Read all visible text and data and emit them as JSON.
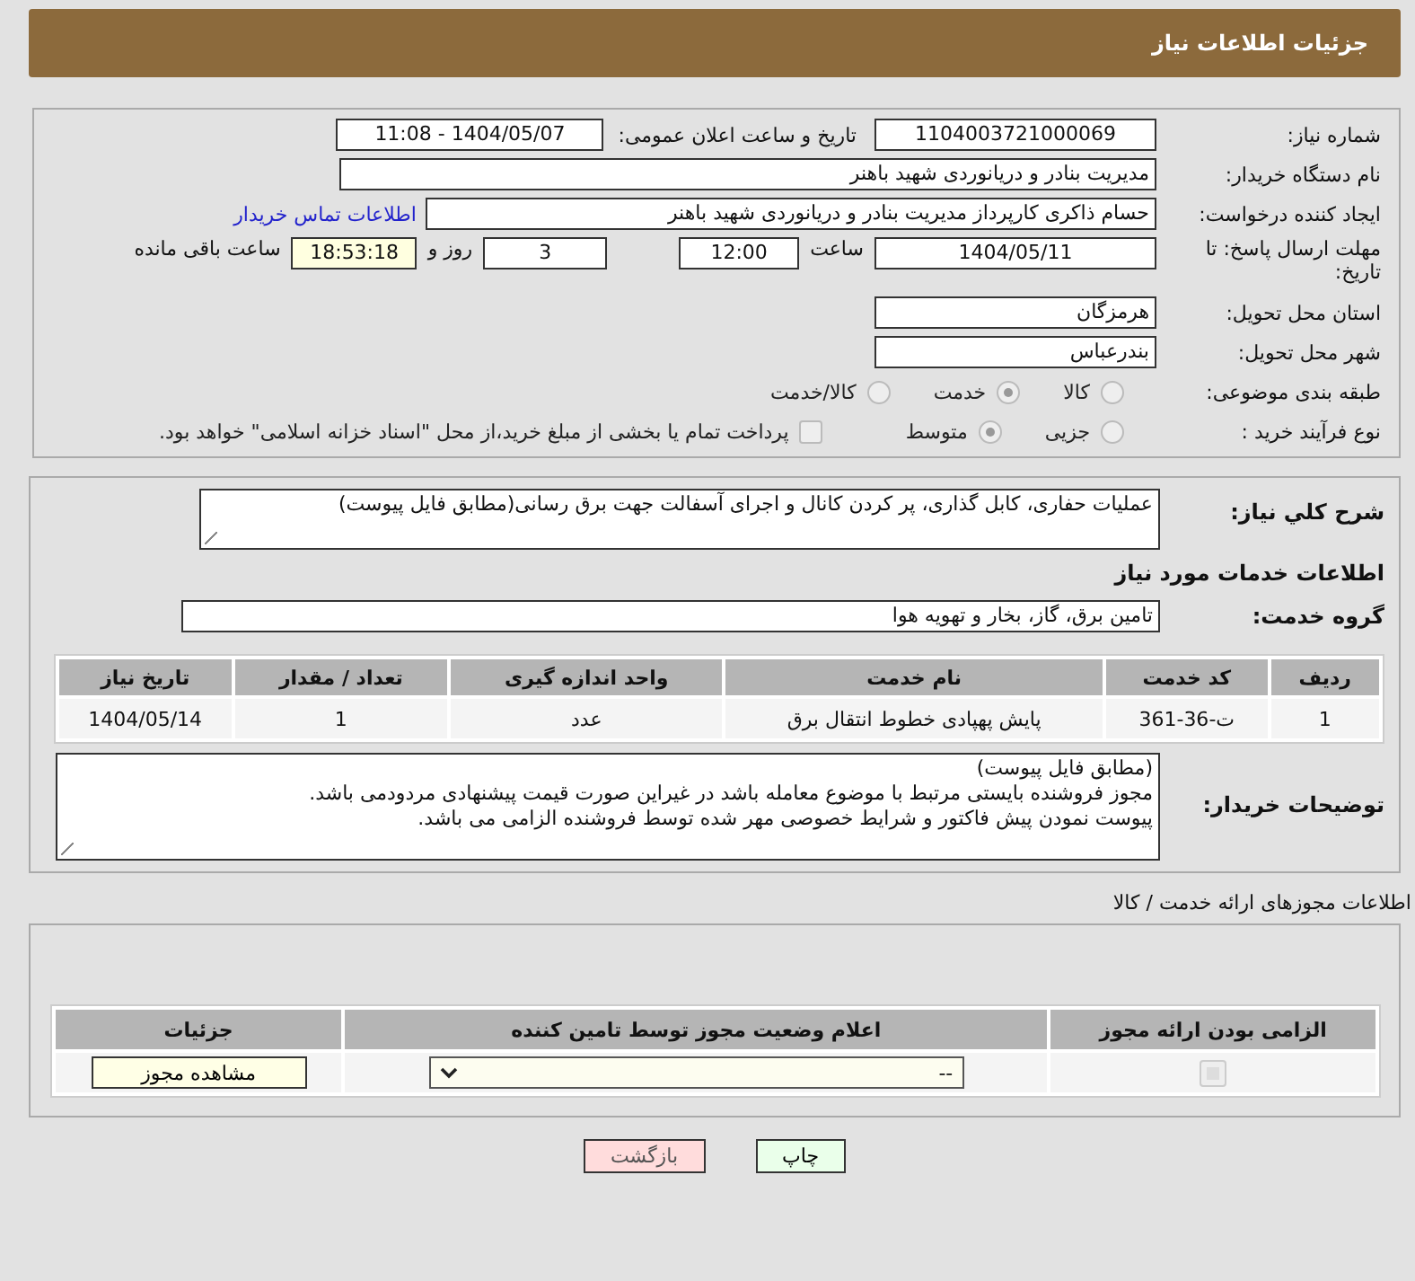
{
  "header": {
    "title": "جزئیات اطلاعات نیاز"
  },
  "details": {
    "need_number": {
      "label": "شماره نیاز:",
      "value": "1104003721000069"
    },
    "announce": {
      "label": "تاریخ و ساعت اعلان عمومی:",
      "value": "1404/05/07 - 11:08"
    },
    "buyer_org": {
      "label": "نام دستگاه خریدار:",
      "value": "مدیریت بنادر و دریانوردی شهید باهنر"
    },
    "requester": {
      "label": "ایجاد کننده درخواست:",
      "value": "حسام  ذاکری کارپرداز مدیریت بنادر و دریانوردی شهید باهنر",
      "link": "اطلاعات تماس خریدار"
    },
    "deadline": {
      "label": "مهلت ارسال پاسخ: تا تاریخ:",
      "date": "1404/05/11",
      "time_label": "ساعت",
      "time": "12:00",
      "days": "3",
      "days_label": "روز و",
      "remaining": "18:53:18",
      "remaining_label": "ساعت باقی مانده"
    },
    "province": {
      "label": "استان محل تحویل:",
      "value": "هرمزگان"
    },
    "city": {
      "label": "شهر محل تحویل:",
      "value": "بندرعباس"
    },
    "category": {
      "label": "طبقه بندی موضوعی:",
      "options": [
        {
          "label": "کالا",
          "selected": false
        },
        {
          "label": "خدمت",
          "selected": true
        },
        {
          "label": "کالا/خدمت",
          "selected": false
        }
      ]
    },
    "process": {
      "label": "نوع فرآیند خرید :",
      "options": [
        {
          "label": "جزیی",
          "selected": false
        },
        {
          "label": "متوسط",
          "selected": true
        }
      ],
      "treasury": {
        "checked": false,
        "label": "پرداخت تمام یا بخشی از مبلغ خرید،از محل \"اسناد خزانه اسلامی\" خواهد بود."
      }
    }
  },
  "services": {
    "summary": {
      "label": "شرح کلي نياز:",
      "value": "عملیات حفاری، کابل گذاری، پر کردن کانال و اجرای آسفالت جهت برق رسانی(مطابق فایل پیوست)"
    },
    "heading": "اطلاعات خدمات مورد نیاز",
    "group": {
      "label": "گروه خدمت:",
      "value": "تامین برق، گاز، بخار و تهویه هوا"
    },
    "table": {
      "columns": [
        "ردیف",
        "کد خدمت",
        "نام خدمت",
        "واحد اندازه گیری",
        "تعداد / مقدار",
        "تاریخ نیاز"
      ],
      "rows": [
        [
          "1",
          "ت-36-361",
          "پایش پهپادی خطوط انتقال برق",
          "عدد",
          "1",
          "1404/05/14"
        ]
      ]
    },
    "notes": {
      "label": "توضیحات خریدار:",
      "lines": [
        "(مطابق فایل پیوست)",
        "مجوز فروشنده بایستی مرتبط با موضوع معامله باشد در غیراین صورت قیمت پیشنهادی مردودمی باشد.",
        "پیوست نمودن پیش فاکتور و شرایط خصوصی مهر شده توسط فروشنده الزامی می باشد."
      ]
    }
  },
  "licenses": {
    "title": "اطلاعات مجوزهای ارائه خدمت / کالا",
    "columns": [
      "الزامی بودن ارائه مجوز",
      "اعلام وضعیت مجوز توسط تامین کننده",
      "جزئیات"
    ],
    "rows": [
      {
        "required": true,
        "status": "--",
        "button": "مشاهده مجوز"
      }
    ]
  },
  "buttons": [
    {
      "label": "چاپ",
      "kind": "print"
    },
    {
      "label": "بازگشت",
      "kind": "back"
    }
  ]
}
